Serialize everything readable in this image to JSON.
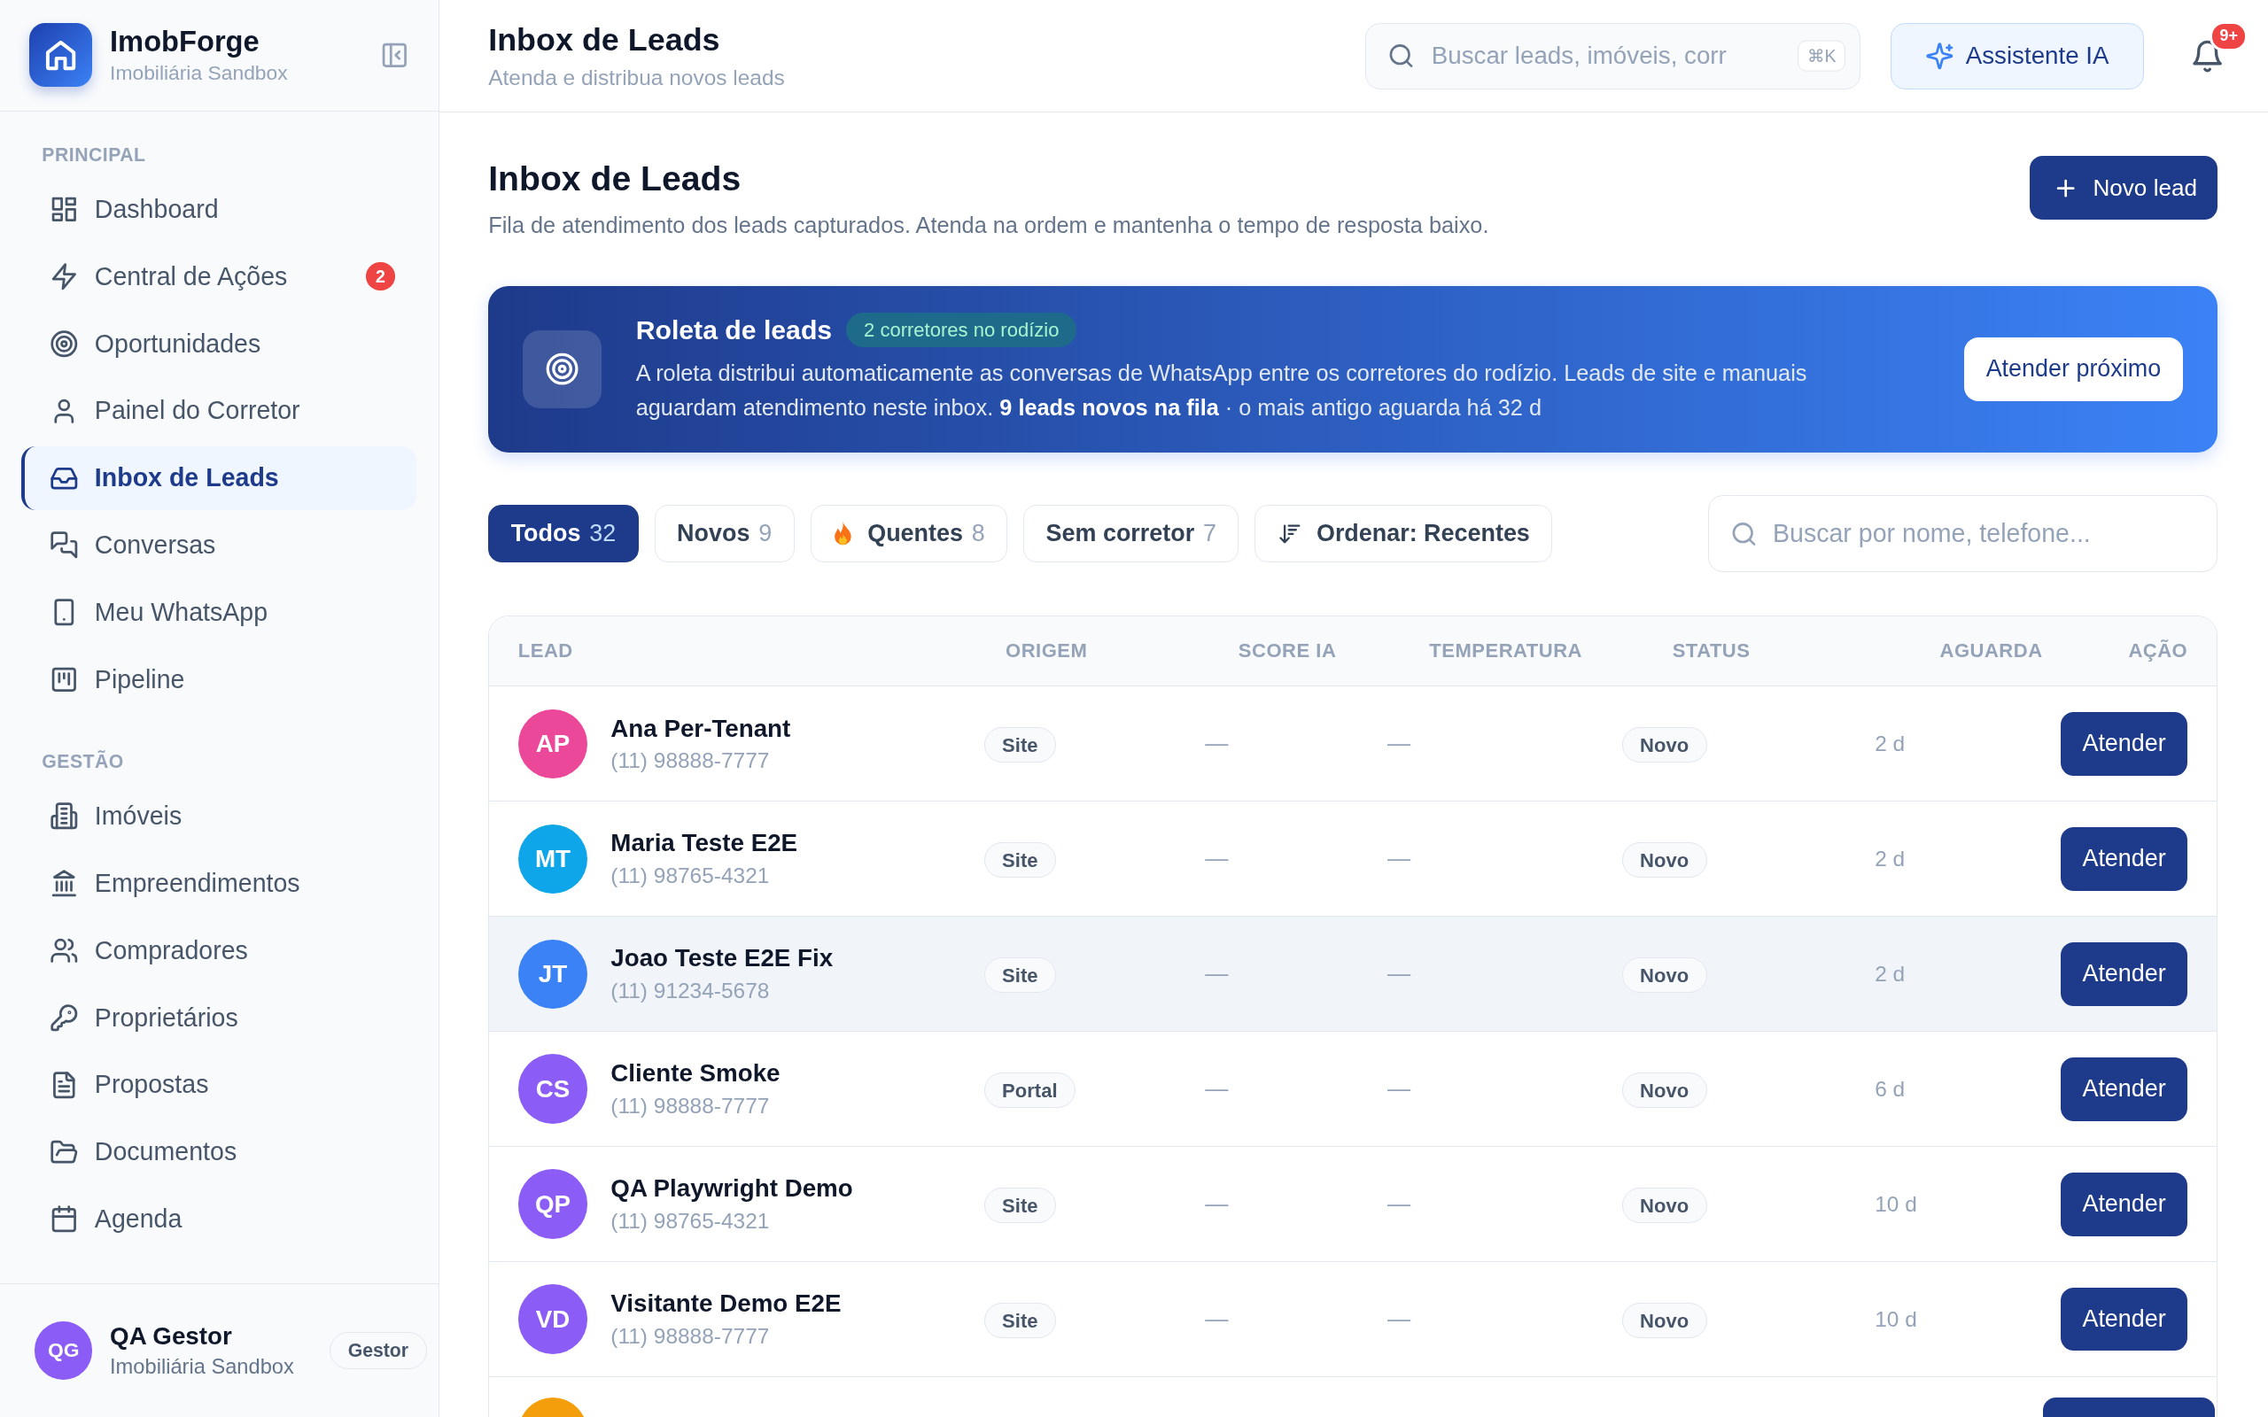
{
  "brand": {
    "name": "ImobForge",
    "subtitle": "Imobiliária Sandbox"
  },
  "sidebar": {
    "sections": [
      {
        "label": "PRINCIPAL",
        "items": [
          {
            "label": "Dashboard",
            "selected": false
          },
          {
            "label": "Central de Ações",
            "selected": false,
            "badge": "2"
          },
          {
            "label": "Oportunidades",
            "selected": false
          },
          {
            "label": "Painel do Corretor",
            "selected": false
          },
          {
            "label": "Inbox de Leads",
            "selected": true
          },
          {
            "label": "Conversas",
            "selected": false
          },
          {
            "label": "Meu WhatsApp",
            "selected": false
          },
          {
            "label": "Pipeline",
            "selected": false
          }
        ]
      },
      {
        "label": "GESTÃO",
        "items": [
          {
            "label": "Imóveis",
            "selected": false
          },
          {
            "label": "Empreendimentos",
            "selected": false
          },
          {
            "label": "Compradores",
            "selected": false
          },
          {
            "label": "Proprietários",
            "selected": false
          },
          {
            "label": "Propostas",
            "selected": false
          },
          {
            "label": "Documentos",
            "selected": false
          },
          {
            "label": "Agenda",
            "selected": false
          }
        ]
      }
    ],
    "user": {
      "initials": "QG",
      "name": "QA Gestor",
      "org": "Imobiliária Sandbox",
      "role": "Gestor"
    }
  },
  "header": {
    "title": "Inbox de Leads",
    "subtitle": "Atenda e distribua novos leads",
    "search": {
      "placeholder": "Buscar leads, imóveis, corr",
      "shortcut": "⌘K"
    },
    "assistant_button": "Assistente IA",
    "notifications_badge": "9+"
  },
  "page": {
    "title": "Inbox de Leads",
    "description": "Fila de atendimento dos leads capturados. Atenda na ordem e mantenha o tempo de resposta baixo.",
    "new_button": "Novo lead"
  },
  "banner": {
    "title": "Roleta de leads",
    "pill": "2 corretores no rodízio",
    "text": "A roleta distribui automaticamente as conversas de WhatsApp entre os corretores do rodízio. Leads de site e manuais aguardam atendimento neste inbox. **9 leads novos na fila** · o mais antigo aguarda há 32 d",
    "button": "Atender próximo"
  },
  "filters": [
    {
      "kind": "filter",
      "label": "Todos",
      "count": "32",
      "selected": true
    },
    {
      "kind": "filter",
      "label": "Novos",
      "count": "9",
      "selected": false
    },
    {
      "kind": "hot",
      "label": "Quentes",
      "count": "8",
      "selected": false
    },
    {
      "kind": "filter",
      "label": "Sem corretor",
      "count": "7",
      "selected": false
    },
    {
      "kind": "sort",
      "label": "Ordenar: Recentes",
      "selected": false
    }
  ],
  "list_search": {
    "placeholder": "Buscar por nome, telefone..."
  },
  "table": {
    "columns": [
      "LEAD",
      "ORIGEM",
      "SCORE IA",
      "TEMPERATURA",
      "STATUS",
      "AGUARDA",
      "AÇÃO"
    ],
    "rows": [
      {
        "initials": "AP",
        "color": "#ec4899",
        "name": "Ana Per-Tenant",
        "phone": "(11) 98888-7777",
        "origin": "Site",
        "score": "—",
        "temperature": "—",
        "status": "Novo",
        "waiting": "2 d",
        "action": "Atender",
        "hovered": false
      },
      {
        "initials": "MT",
        "color": "#0ea5e9",
        "name": "Maria Teste E2E",
        "phone": "(11) 98765-4321",
        "origin": "Site",
        "score": "—",
        "temperature": "—",
        "status": "Novo",
        "waiting": "2 d",
        "action": "Atender",
        "hovered": false
      },
      {
        "initials": "JT",
        "color": "#3b82f6",
        "name": "Joao Teste E2E Fix",
        "phone": "(11) 91234-5678",
        "origin": "Site",
        "score": "—",
        "temperature": "—",
        "status": "Novo",
        "waiting": "2 d",
        "action": "Atender",
        "hovered": true
      },
      {
        "initials": "CS",
        "color": "#8b5cf6",
        "name": "Cliente Smoke",
        "phone": "(11) 98888-7777",
        "origin": "Portal",
        "score": "—",
        "temperature": "—",
        "status": "Novo",
        "waiting": "6 d",
        "action": "Atender",
        "hovered": false
      },
      {
        "initials": "QP",
        "color": "#8b5cf6",
        "name": "QA Playwright Demo",
        "phone": "(11) 98765-4321",
        "origin": "Site",
        "score": "—",
        "temperature": "—",
        "status": "Novo",
        "waiting": "10 d",
        "action": "Atender",
        "hovered": false
      },
      {
        "initials": "VD",
        "color": "#8b5cf6",
        "name": "Visitante Demo E2E",
        "phone": "(11) 98888-7777",
        "origin": "Site",
        "score": "—",
        "temperature": "—",
        "status": "Novo",
        "waiting": "10 d",
        "action": "Atender",
        "hovered": false
      }
    ],
    "partial_row": {
      "color": "#f59e0b"
    }
  }
}
